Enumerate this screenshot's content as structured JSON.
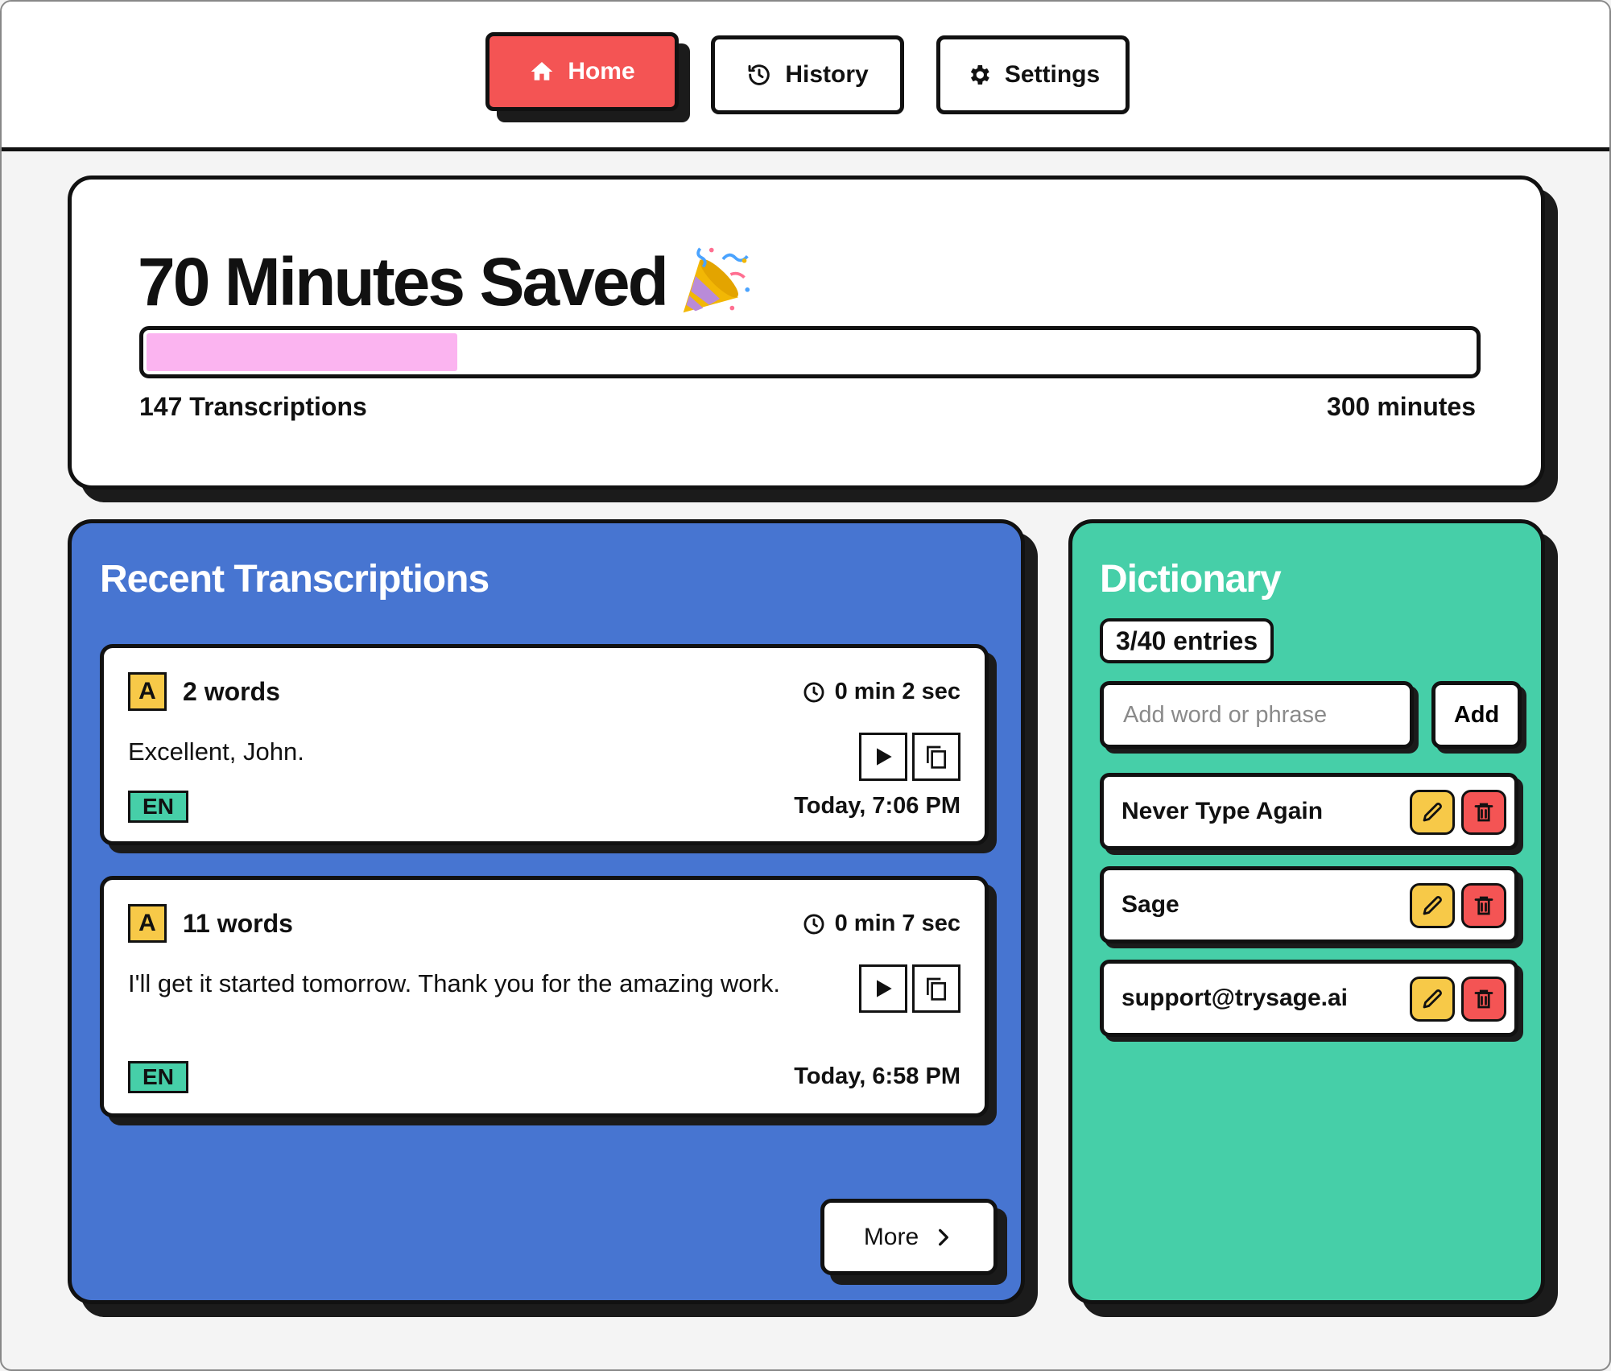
{
  "nav": {
    "tabs": [
      {
        "label": "Home",
        "icon": "home-icon",
        "active": true
      },
      {
        "label": "History",
        "icon": "history-icon",
        "active": false
      },
      {
        "label": "Settings",
        "icon": "gear-icon",
        "active": false
      }
    ]
  },
  "stats": {
    "title": "70 Minutes Saved",
    "title_icon": "party-popper-icon",
    "progress_fraction": 0.233,
    "transcriptions_label": "147 Transcriptions",
    "goal_label": "300 minutes"
  },
  "recent": {
    "title": "Recent Transcriptions",
    "items": [
      {
        "badge": "A",
        "words": "2 words",
        "duration": "0 min 2 sec",
        "text": "Excellent, John.",
        "lang": "EN",
        "timestamp": "Today, 7:06 PM"
      },
      {
        "badge": "A",
        "words": "11 words",
        "duration": "0 min 7 sec",
        "text": "I'll get it started tomorrow. Thank you for the amazing work.",
        "lang": "EN",
        "timestamp": "Today, 6:58 PM"
      }
    ],
    "more_label": "More"
  },
  "dictionary": {
    "title": "Dictionary",
    "entry_count": "3/40 entries",
    "input_placeholder": "Add word or phrase",
    "input_value": "",
    "add_label": "Add",
    "entries": [
      "Never Type Again",
      "Sage",
      "support@trysage.ai"
    ]
  },
  "colors": {
    "accent_red": "#f45454",
    "blue_panel": "#4775d1",
    "green_panel": "#46cfa8",
    "progress_pink": "#fbb4f0",
    "badge_yellow": "#f7c948"
  }
}
